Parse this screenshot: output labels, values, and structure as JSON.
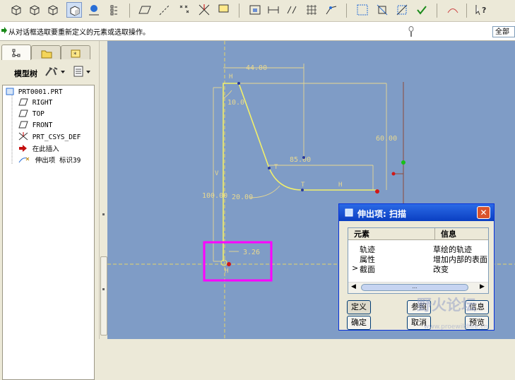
{
  "message": {
    "text": "从对话框选取要重新定义的元素或选取操作。"
  },
  "filter": {
    "value": "全部"
  },
  "panel": {
    "title": "模型树"
  },
  "tree": {
    "items": [
      {
        "label": "PRT0001.PRT",
        "icon": "part-icon"
      },
      {
        "label": "RIGHT",
        "icon": "datum-plane-icon"
      },
      {
        "label": "TOP",
        "icon": "datum-plane-icon"
      },
      {
        "label": "FRONT",
        "icon": "datum-plane-icon"
      },
      {
        "label": "PRT_CSYS_DEF",
        "icon": "csys-icon"
      },
      {
        "label": "在此插入",
        "icon": "insert-arrow-icon"
      },
      {
        "label": "伸出项 标识39",
        "icon": "sweep-feature-icon"
      }
    ]
  },
  "sketch": {
    "dims": [
      "44.00",
      "10.0",
      "60.00",
      "85.00",
      "100.00",
      "20.00",
      "3.26"
    ],
    "constraints": [
      "H",
      "T",
      "T",
      "H",
      "V",
      "H"
    ]
  },
  "dialog": {
    "title": "伸出项: 扫描",
    "columns": [
      "元素",
      "信息"
    ],
    "rows": [
      {
        "element": "轨迹",
        "info": "草绘的轨迹"
      },
      {
        "element": "属性",
        "info": "增加内部的表面"
      },
      {
        "element": "截面",
        "info": "改变"
      }
    ],
    "current_marker": ">",
    "scroll_grip": "...",
    "buttons": {
      "define": "定义",
      "refs": "参照",
      "info": "信息",
      "ok": "确定",
      "cancel": "取消",
      "preview": "预览"
    }
  },
  "watermark": {
    "text": "野火论坛",
    "url": "www.proewildfire.cn"
  },
  "colors": {
    "canvas": "#7f9cc6",
    "sketch": "#f3f06a",
    "dimension": "#e8d890",
    "highlight": "#ff00ff",
    "titlebar": "#0a3fc2"
  }
}
